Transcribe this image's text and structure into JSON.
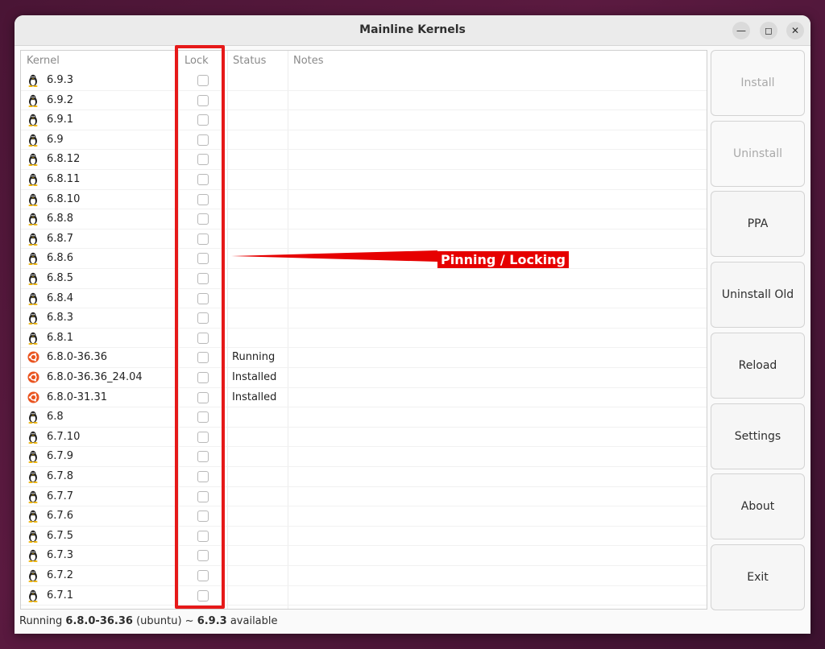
{
  "window": {
    "title": "Mainline Kernels"
  },
  "table": {
    "headers": {
      "kernel": "Kernel",
      "lock": "Lock",
      "status": "Status",
      "notes": "Notes"
    },
    "rows": [
      {
        "name": "6.9.3",
        "icon": "tux-icon",
        "status": ""
      },
      {
        "name": "6.9.2",
        "icon": "tux-icon",
        "status": ""
      },
      {
        "name": "6.9.1",
        "icon": "tux-icon",
        "status": ""
      },
      {
        "name": "6.9",
        "icon": "tux-icon",
        "status": ""
      },
      {
        "name": "6.8.12",
        "icon": "tux-icon",
        "status": ""
      },
      {
        "name": "6.8.11",
        "icon": "tux-icon",
        "status": ""
      },
      {
        "name": "6.8.10",
        "icon": "tux-icon",
        "status": ""
      },
      {
        "name": "6.8.8",
        "icon": "tux-icon",
        "status": ""
      },
      {
        "name": "6.8.7",
        "icon": "tux-icon",
        "status": ""
      },
      {
        "name": "6.8.6",
        "icon": "tux-icon",
        "status": ""
      },
      {
        "name": "6.8.5",
        "icon": "tux-icon",
        "status": ""
      },
      {
        "name": "6.8.4",
        "icon": "tux-icon",
        "status": ""
      },
      {
        "name": "6.8.3",
        "icon": "tux-icon",
        "status": ""
      },
      {
        "name": "6.8.1",
        "icon": "tux-icon",
        "status": ""
      },
      {
        "name": "6.8.0-36.36",
        "icon": "ubuntu-icon",
        "status": "Running"
      },
      {
        "name": "6.8.0-36.36_24.04",
        "icon": "ubuntu-icon",
        "status": "Installed"
      },
      {
        "name": "6.8.0-31.31",
        "icon": "ubuntu-icon",
        "status": "Installed"
      },
      {
        "name": "6.8",
        "icon": "tux-icon",
        "status": ""
      },
      {
        "name": "6.7.10",
        "icon": "tux-icon",
        "status": ""
      },
      {
        "name": "6.7.9",
        "icon": "tux-icon",
        "status": ""
      },
      {
        "name": "6.7.8",
        "icon": "tux-icon",
        "status": ""
      },
      {
        "name": "6.7.7",
        "icon": "tux-icon",
        "status": ""
      },
      {
        "name": "6.7.6",
        "icon": "tux-icon",
        "status": ""
      },
      {
        "name": "6.7.5",
        "icon": "tux-icon",
        "status": ""
      },
      {
        "name": "6.7.3",
        "icon": "tux-icon",
        "status": ""
      },
      {
        "name": "6.7.2",
        "icon": "tux-icon",
        "status": ""
      },
      {
        "name": "6.7.1",
        "icon": "tux-icon",
        "status": ""
      }
    ]
  },
  "annotation": {
    "label": "Pinning / Locking",
    "color": "#e60000"
  },
  "buttons": [
    {
      "label": "Install",
      "disabled": true
    },
    {
      "label": "Uninstall",
      "disabled": true
    },
    {
      "label": "PPA",
      "disabled": false
    },
    {
      "label": "Uninstall Old",
      "disabled": false
    },
    {
      "label": "Reload",
      "disabled": false
    },
    {
      "label": "Settings",
      "disabled": false
    },
    {
      "label": "About",
      "disabled": false
    },
    {
      "label": "Exit",
      "disabled": false
    }
  ],
  "statusbar": {
    "prefix": "Running ",
    "running": "6.8.0-36.36",
    "middle": " (ubuntu) ~ ",
    "available": "6.9.3",
    "suffix": " available"
  }
}
